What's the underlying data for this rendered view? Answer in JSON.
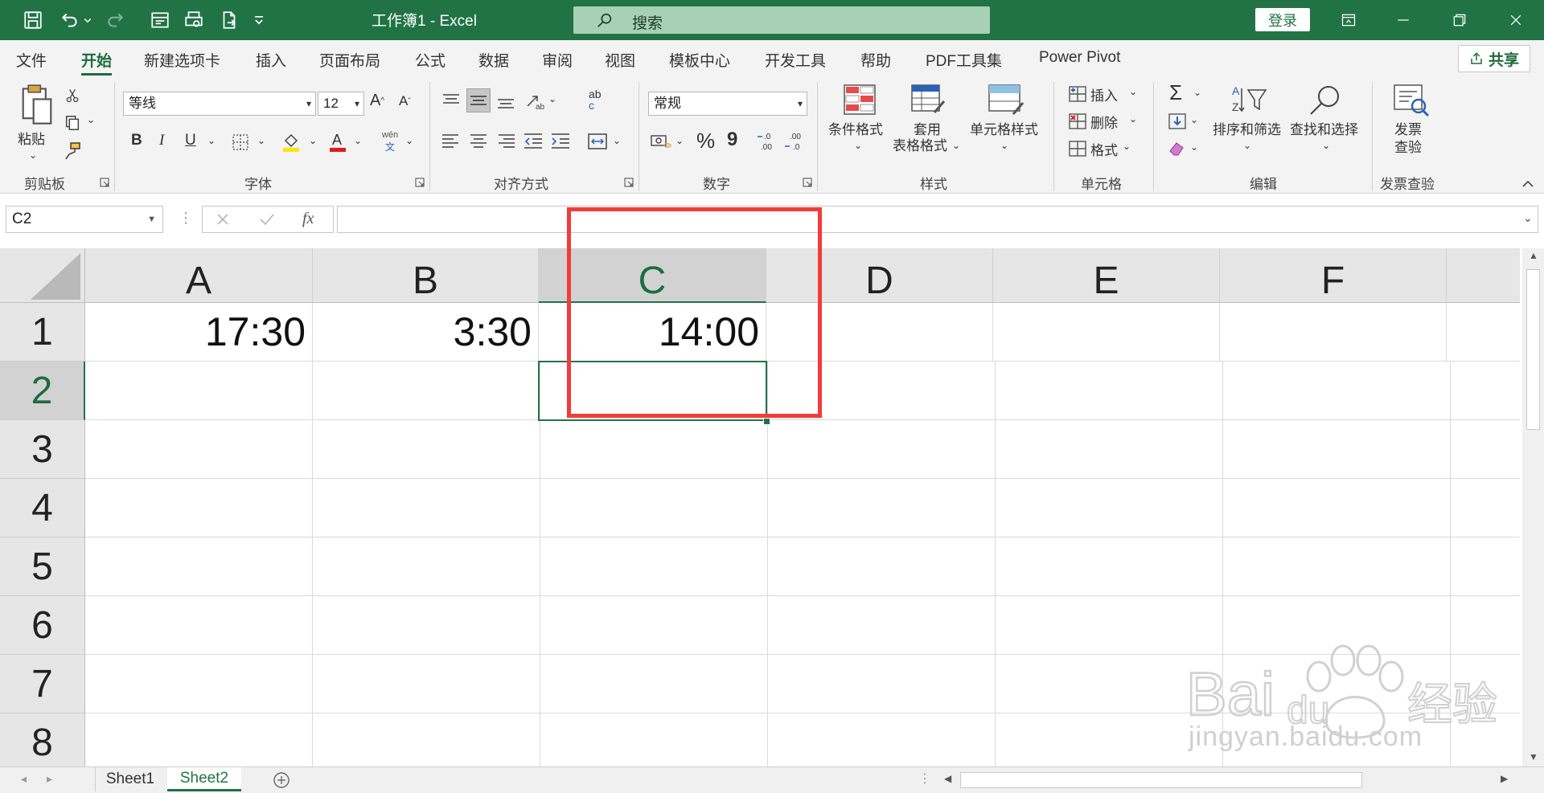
{
  "window": {
    "doc_title": "工作簿1 - Excel",
    "search_label": "搜索",
    "login_label": "登录",
    "accent_color": "#217346",
    "quick_access_icons": [
      "save-icon",
      "undo-icon",
      "redo-icon",
      "form-icon",
      "print-preview-icon",
      "export-pdf-icon",
      "customize-icon"
    ]
  },
  "tabs": [
    {
      "label": "文件"
    },
    {
      "label": "开始"
    },
    {
      "label": "新建选项卡"
    },
    {
      "label": "插入"
    },
    {
      "label": "页面布局"
    },
    {
      "label": "公式"
    },
    {
      "label": "数据"
    },
    {
      "label": "审阅"
    },
    {
      "label": "视图"
    },
    {
      "label": "模板中心"
    },
    {
      "label": "开发工具"
    },
    {
      "label": "帮助"
    },
    {
      "label": "PDF工具集"
    },
    {
      "label": "Power Pivot"
    }
  ],
  "active_tab": "开始",
  "share_label": "共享",
  "ribbon": {
    "clipboard": {
      "paste_label": "粘贴",
      "group_label": "剪贴板"
    },
    "font": {
      "font_name": "等线",
      "font_size": "12",
      "bold": "B",
      "italic": "I",
      "underline": "U",
      "phonetic_top": "wén",
      "phonetic_bottom": "文",
      "group_label": "字体"
    },
    "alignment": {
      "group_label": "对齐方式",
      "wrap_top": "ab",
      "wrap_bottom": "c"
    },
    "number": {
      "format": "常规",
      "percent": "%",
      "comma": "9",
      "group_label": "数字"
    },
    "styles": {
      "conditional_label": "条件格式",
      "table_label_1": "套用",
      "table_label_2": "表格格式",
      "cell_styles_label": "单元格样式",
      "group_label": "样式"
    },
    "cells": {
      "insert_label": "插入",
      "delete_label": "删除",
      "format_label": "格式",
      "group_label": "单元格"
    },
    "editing": {
      "sort_label": "排序和筛选",
      "find_label": "查找和选择",
      "group_label": "编辑"
    },
    "invoice": {
      "label_1": "发票",
      "label_2": "查验",
      "group_label": "发票查验"
    }
  },
  "formula_bar": {
    "name_box": "C2",
    "fx": "fx",
    "formula": ""
  },
  "sheet": {
    "columns": [
      "A",
      "B",
      "C",
      "D",
      "E",
      "F"
    ],
    "rows": [
      "1",
      "2",
      "3",
      "4",
      "5",
      "6",
      "7",
      "8"
    ],
    "selected_cell": "C2",
    "cells": {
      "A1": "17:30",
      "B1": "3:30",
      "C1": "14:00"
    }
  },
  "sheets": [
    {
      "label": "Sheet1"
    },
    {
      "label": "Sheet2"
    }
  ],
  "active_sheet": "Sheet2",
  "annotation_color": "#f23c3c",
  "watermark": {
    "text": "jingyan.baidu.com"
  }
}
